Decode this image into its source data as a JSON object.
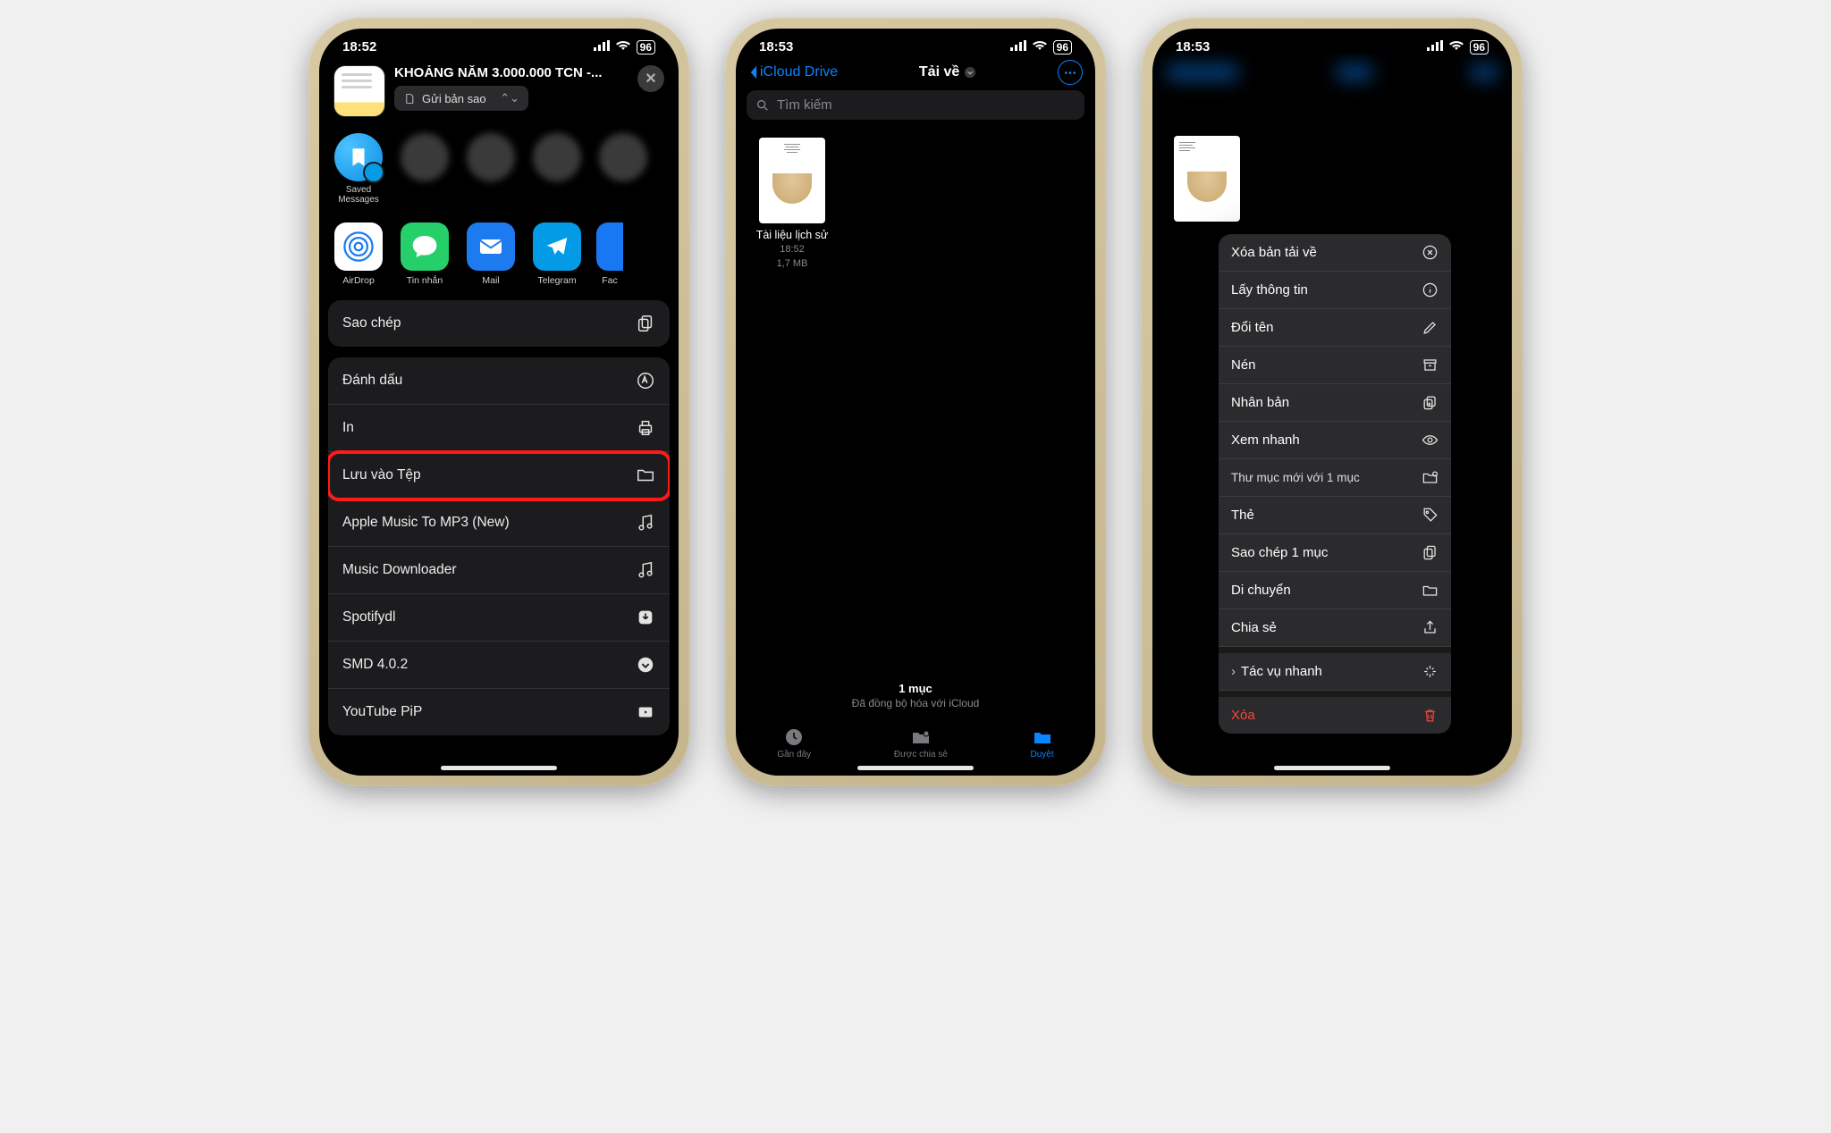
{
  "phone1": {
    "time": "18:52",
    "battery": "96",
    "header": {
      "title": "KHOẢNG NĂM 3.000.000 TCN -...",
      "picker": "Gửi bản sao"
    },
    "contacts": [
      {
        "name": "Saved Messages"
      }
    ],
    "apps": [
      {
        "name": "AirDrop"
      },
      {
        "name": "Tin nhắn"
      },
      {
        "name": "Mail"
      },
      {
        "name": "Telegram"
      },
      {
        "name": "Fac"
      }
    ],
    "actions_g1": [
      "Sao chép"
    ],
    "actions_g2": [
      "Đánh dấu",
      "In",
      "Lưu vào Tệp",
      "Apple Music To MP3 (New)",
      "Music Downloader",
      "Spotifydl",
      "SMD 4.0.2",
      "YouTube PiP"
    ],
    "highlight_index": 2
  },
  "phone2": {
    "time": "18:53",
    "battery": "96",
    "back": "iCloud Drive",
    "title": "Tải về",
    "search_placeholder": "Tìm kiếm",
    "file": {
      "name": "Tài liệu lịch sử",
      "time": "18:52",
      "size": "1,7 MB"
    },
    "status": {
      "count": "1 mục",
      "sync": "Đã đồng bộ hóa với iCloud"
    },
    "tabs": [
      "Gần đây",
      "Được chia sẻ",
      "Duyệt"
    ]
  },
  "phone3": {
    "time": "18:53",
    "battery": "96",
    "menu": [
      "Xóa bản tải về",
      "Lấy thông tin",
      "Đổi tên",
      "Nén",
      "Nhân bản",
      "Xem nhanh",
      "Thư mục mới với 1 mục",
      "Thẻ",
      "Sao chép 1 mục",
      "Di chuyển",
      "Chia sẻ"
    ],
    "quick": "Tác vụ nhanh",
    "delete": "Xóa"
  }
}
